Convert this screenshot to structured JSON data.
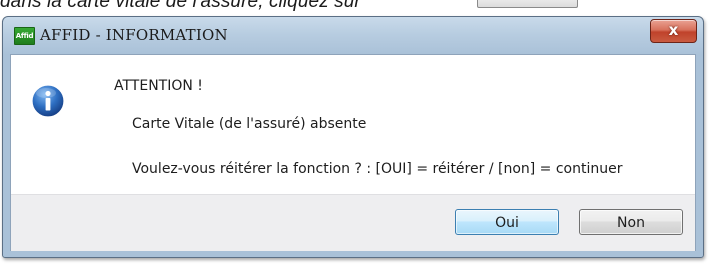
{
  "document": {
    "instruction_text": "dans la carte vitale de l'assuré, cliquez sur"
  },
  "window": {
    "title": "AFFID - INFORMATION",
    "app_icon": "affid-icon",
    "app_icon_text": "Affid",
    "close_label": "x"
  },
  "message": {
    "icon": "information-icon",
    "heading": "ATTENTION !",
    "line1": "Carte Vitale (de l'assuré) absente",
    "line2": "Voulez-vous réitérer la fonction ? : [OUI] = réitérer / [non] = continuer"
  },
  "buttons": {
    "yes_label": "Oui",
    "no_label": "Non"
  },
  "colors": {
    "info_icon": "#2e6fc2",
    "default_button_border": "#3c7fb1",
    "close_button": "#c0422b"
  }
}
